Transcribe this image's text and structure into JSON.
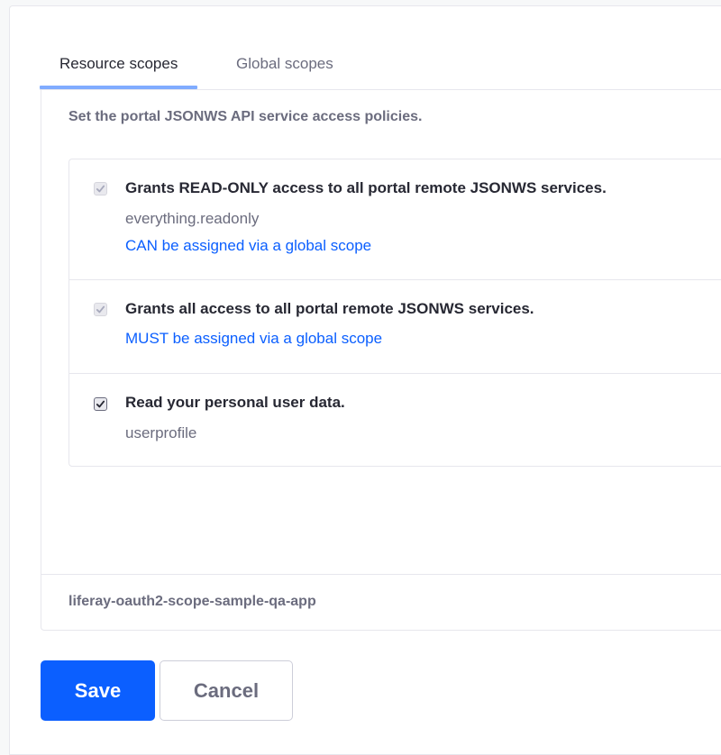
{
  "tabs": [
    {
      "label": "Resource scopes",
      "active": true
    },
    {
      "label": "Global scopes",
      "active": false
    }
  ],
  "panel": {
    "description": "Set the portal JSONWS API service access policies.",
    "scopes": [
      {
        "title": "Grants READ-ONLY access to all portal remote JSONWS services.",
        "name": "everything.readonly",
        "note": "CAN be assigned via a global scope",
        "checked": true,
        "disabled": true
      },
      {
        "title": "Grants all access to all portal remote JSONWS services.",
        "note": "MUST be assigned via a global scope",
        "checked": true,
        "disabled": true
      },
      {
        "title": "Read your personal user data.",
        "name": "userprofile",
        "checked": true,
        "disabled": false
      }
    ],
    "footer": "liferay-oauth2-scope-sample-qa-app"
  },
  "actions": {
    "save_label": "Save",
    "cancel_label": "Cancel"
  },
  "colors": {
    "primary": "#0b5fff",
    "tab_indicator": "#80acff",
    "secondary_text": "#6b6c7e"
  }
}
